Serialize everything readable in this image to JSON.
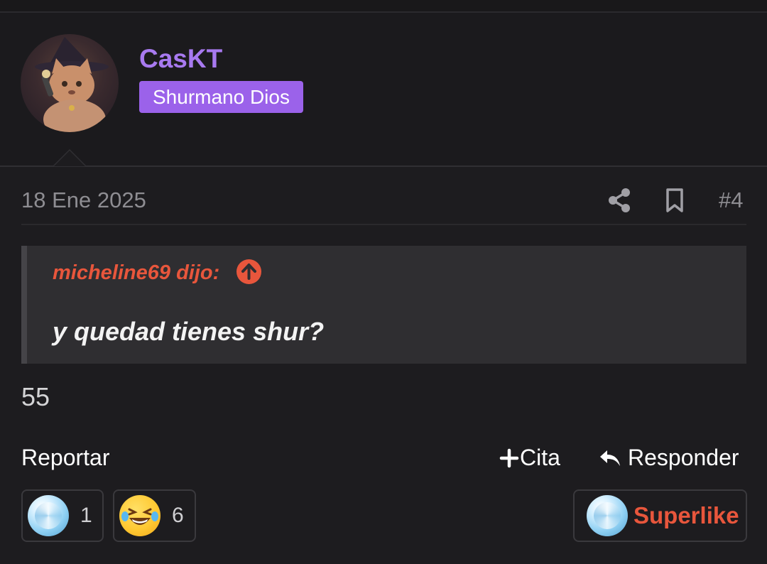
{
  "post": {
    "author": "CasKT",
    "rank_badge": "Shurmano Dios",
    "date": "18 Ene 2025",
    "post_number": "#4",
    "quote": {
      "author_label": "micheline69 dijo:",
      "text": "y quedad tienes shur?"
    },
    "message": "55"
  },
  "actions": {
    "report": "Reportar",
    "quote": "Cita",
    "reply": "Responder"
  },
  "reactions": [
    {
      "icon": "diamond-icon",
      "count": "1"
    },
    {
      "icon": "laughing-tears-emoji-icon",
      "count": "6"
    }
  ],
  "superlike": {
    "label": "Superlike",
    "icon": "diamond-icon"
  },
  "colors": {
    "background": "#1d1c1f",
    "username": "#a87af0",
    "badge": "#9b62ea",
    "accent_red": "#e8563c",
    "quote_bg": "#2f2e31"
  }
}
